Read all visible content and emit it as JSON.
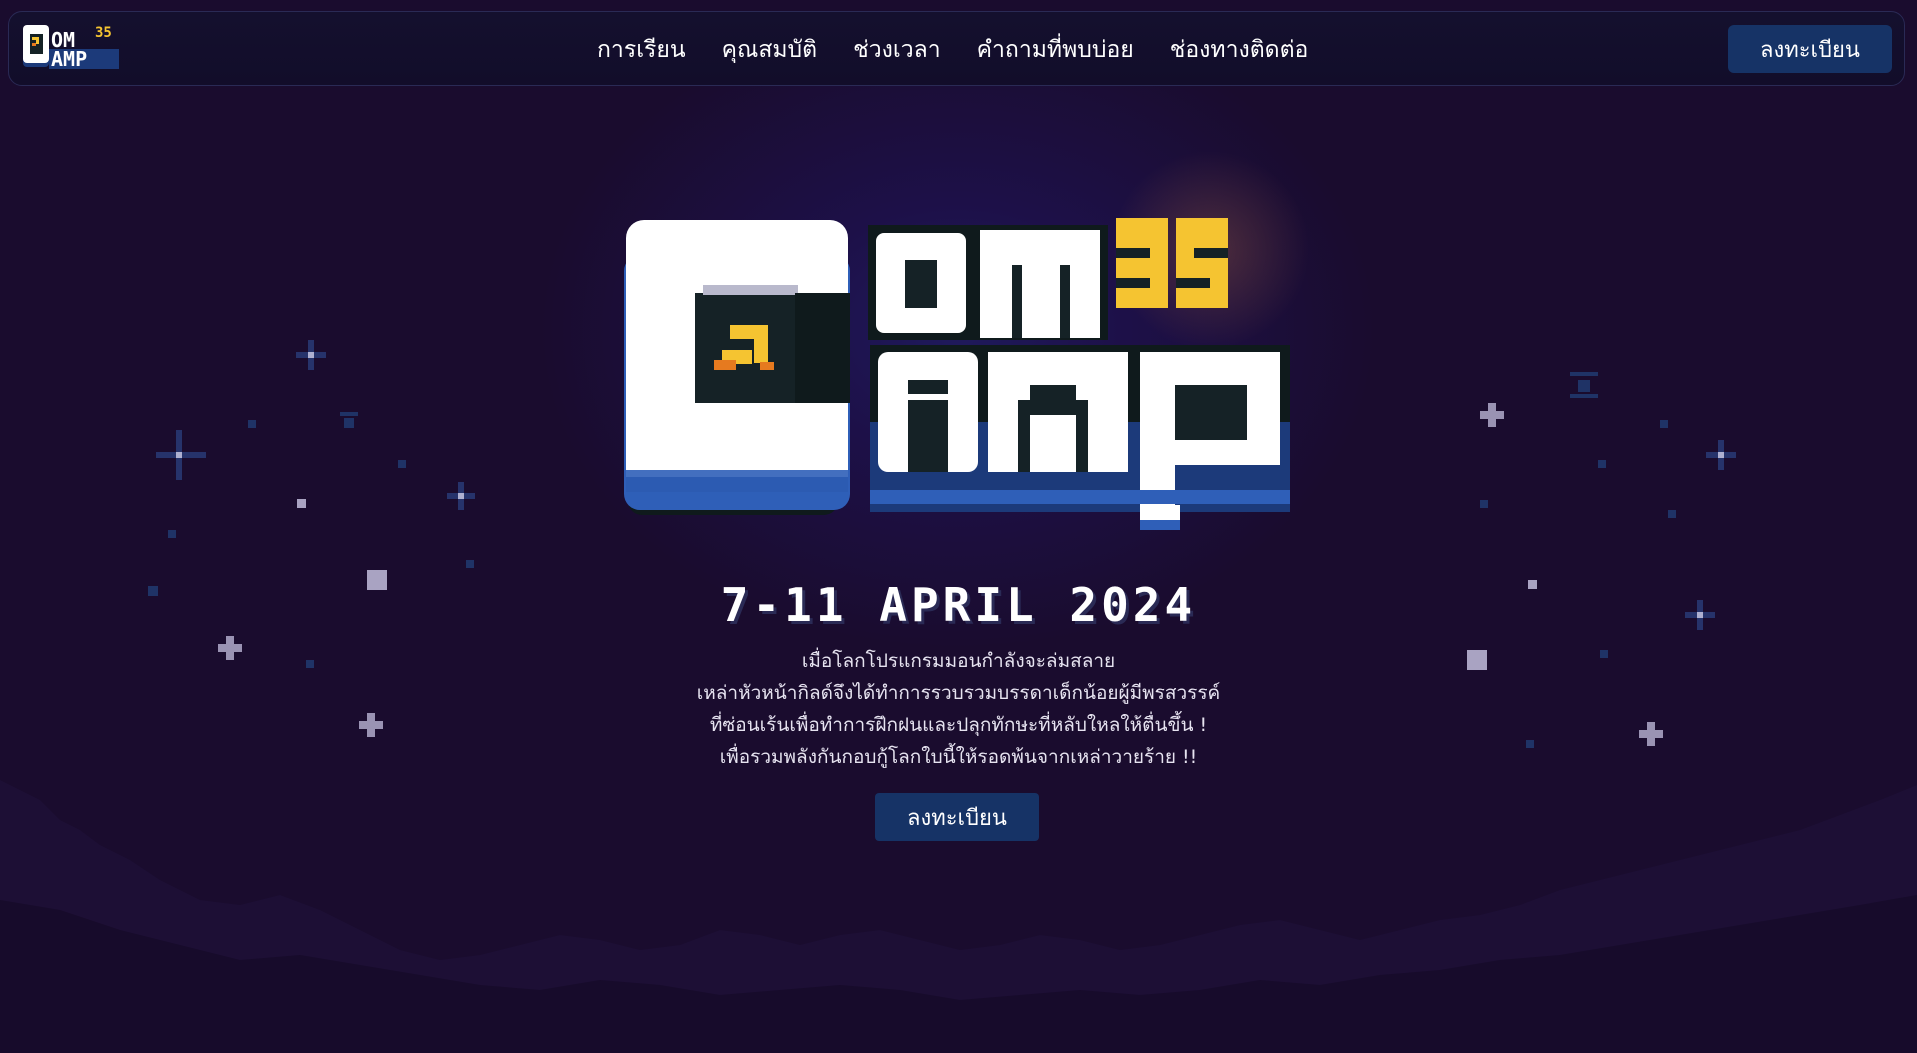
{
  "nav": {
    "logo_alt": "ComCamp 35",
    "links": [
      "การเรียน",
      "คุณสมบัติ",
      "ช่วงเวลา",
      "คำถามที่พบบ่อย",
      "ช่องทางติดต่อ"
    ],
    "register_label": "ลงทะเบียน"
  },
  "hero": {
    "logo": {
      "word_top": "OM",
      "word_bottom": "AMP",
      "letter": "C",
      "number": "35"
    },
    "date": "7-11 APRIL 2024",
    "description": [
      "เมื่อโลกโปรแกรมมอนกำลังจะล่มสลาย",
      "เหล่าหัวหน้ากิลด์จึงได้ทำการรวบรวมบรรดาเด็กน้อยผู้มีพรสวรรค์",
      "ที่ซ่อนเร้นเพื่อทำการฝึกฝนและปลุกทักษะที่หลับใหลให้ตื่นขึ้น !",
      "เพื่อรวมพลังกันกอบกู้โลกใบนี้ให้รอดพ้นจากเหล่าวายร้าย !!"
    ],
    "register_label": "ลงทะเบียน"
  },
  "colors": {
    "background": "#1a0c2e",
    "button": "#163366",
    "accent_yellow": "#f5c431",
    "logo_blue": "#1c3a7a"
  },
  "icons": [
    "arrow-cursor-icon",
    "sparkle-star-icon",
    "plus-star-icon"
  ]
}
